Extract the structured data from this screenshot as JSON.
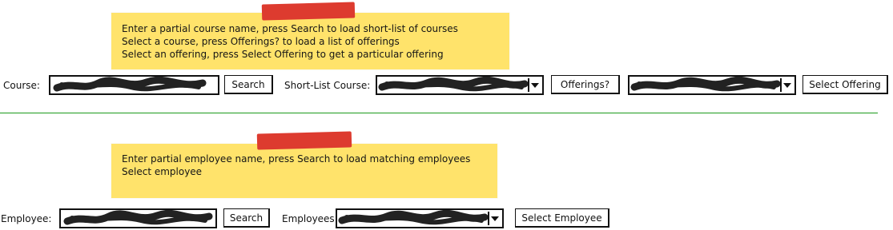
{
  "course_section": {
    "note_lines": [
      "Enter a partial course name, press Search to load short-list of courses",
      "Select a course, press Offerings? to load a list of offerings",
      "Select an offering, press Select Offering to get a particular offering"
    ],
    "course_label": "Course:",
    "search_label": "Search",
    "shortlist_label": "Short-List Course:",
    "offerings_label": "Offerings?",
    "select_offering_label": "Select Offering"
  },
  "employee_section": {
    "note_lines": [
      "Enter partial employee name, press Search to load matching employees",
      "Select employee"
    ],
    "employee_label": "Employee:",
    "search_label": "Search",
    "employees_label": "Employees:",
    "select_employee_label": "Select Employee"
  },
  "colors": {
    "note_yellow": "#ffe36b",
    "tape_red": "#dd3b2f",
    "divider_green": "#1a9a1a"
  }
}
